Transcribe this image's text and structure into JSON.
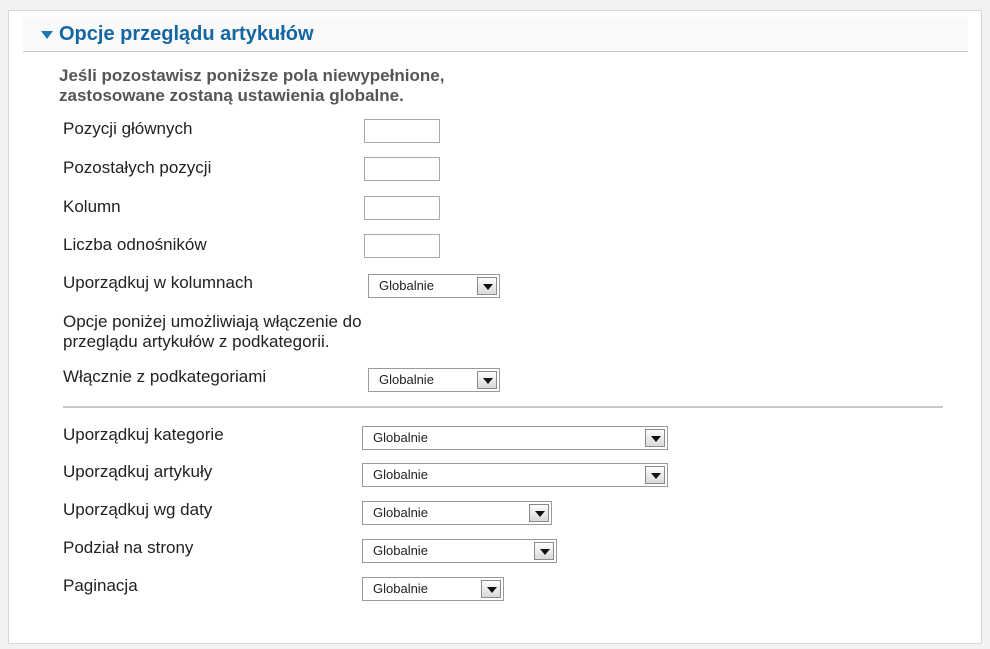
{
  "panel": {
    "title": "Opcje przeglądu artykułów",
    "toggle_icon": "triangle-down-icon",
    "accent_color": "#1467a3"
  },
  "intro": {
    "line1": "Jeśli pozostawisz poniższe pola niewypełnione,",
    "line2": "zastosowane zostaną ustawienia globalne."
  },
  "fields": {
    "main_items": {
      "label": "Pozycji głównych",
      "value": ""
    },
    "other_items": {
      "label": "Pozostałych pozycji",
      "value": ""
    },
    "columns": {
      "label": "Kolumn",
      "value": ""
    },
    "links": {
      "label": "Liczba odnośników",
      "value": ""
    }
  },
  "column_order": {
    "label": "Uporządkuj w kolumnach",
    "value": "Globalnie"
  },
  "subcat_info": {
    "line1": "Opcje poniżej umożliwiają włączenie do",
    "line2": "przeglądu artykułów z podkategorii."
  },
  "include_subcats": {
    "label": "Włącznie z podkategoriami",
    "value": "Globalnie"
  },
  "ordering": {
    "category_order": {
      "label": "Uporządkuj kategorie",
      "value": "Globalnie"
    },
    "article_order": {
      "label": "Uporządkuj artykuły",
      "value": "Globalnie"
    },
    "date_order": {
      "label": "Uporządkuj wg daty",
      "value": "Globalnie"
    },
    "pagination": {
      "label": "Podział na strony",
      "value": "Globalnie"
    },
    "pagination_results": {
      "label": "Paginacja",
      "value": "Globalnie"
    }
  }
}
